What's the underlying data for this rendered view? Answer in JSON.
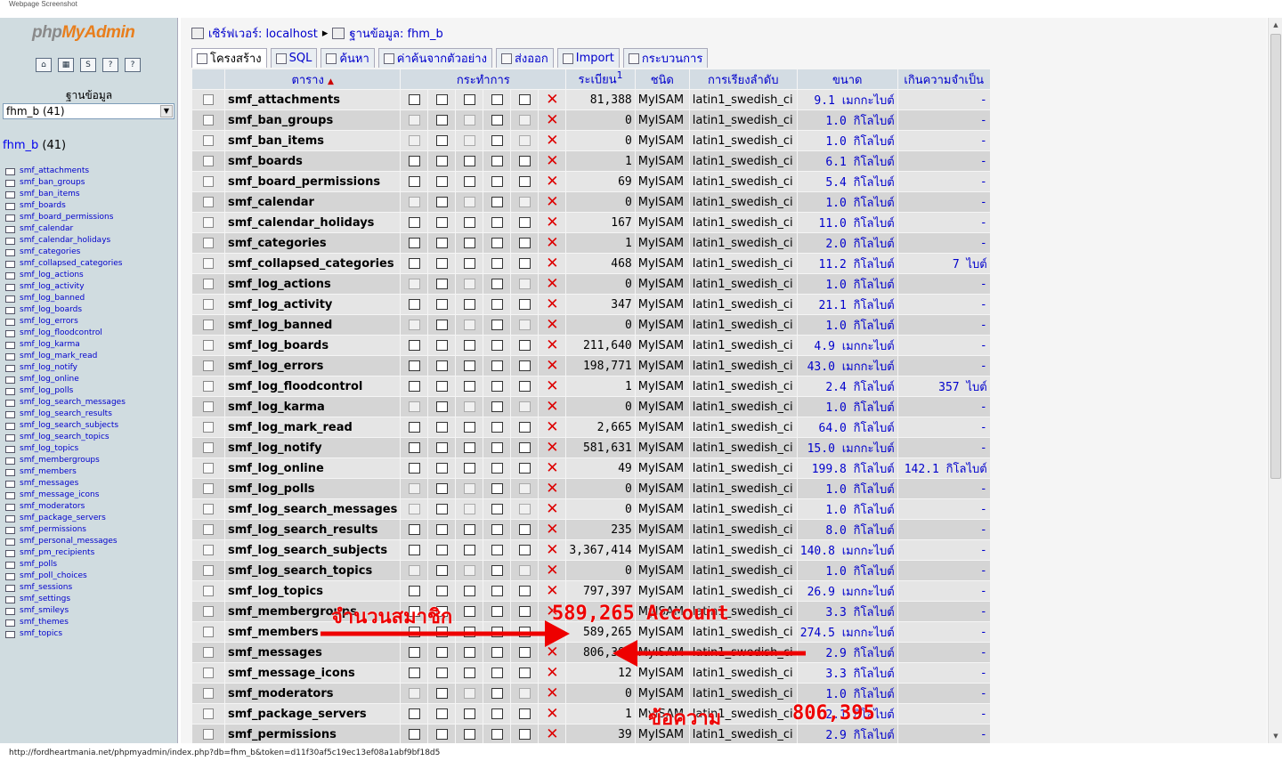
{
  "caption": "Webpage Screenshot",
  "status_url": "http://fordheartmania.net/phpmyadmin/index.php?db=fhm_b&token=d11f30af5c19ec13ef08a1abf9bf18d5",
  "left": {
    "logo": {
      "php": "php",
      "my": "My",
      "admin": "Admin"
    },
    "icons": [
      "home-icon",
      "query-window-icon",
      "sql-icon",
      "docs-icon",
      "help-icon"
    ],
    "db_label": "ฐานข้อมูล",
    "db_select": "fhm_b (41)",
    "db_link": "fhm_b",
    "db_count": "(41)",
    "tables": [
      "smf_attachments",
      "smf_ban_groups",
      "smf_ban_items",
      "smf_boards",
      "smf_board_permissions",
      "smf_calendar",
      "smf_calendar_holidays",
      "smf_categories",
      "smf_collapsed_categories",
      "smf_log_actions",
      "smf_log_activity",
      "smf_log_banned",
      "smf_log_boards",
      "smf_log_errors",
      "smf_log_floodcontrol",
      "smf_log_karma",
      "smf_log_mark_read",
      "smf_log_notify",
      "smf_log_online",
      "smf_log_polls",
      "smf_log_search_messages",
      "smf_log_search_results",
      "smf_log_search_subjects",
      "smf_log_search_topics",
      "smf_log_topics",
      "smf_membergroups",
      "smf_members",
      "smf_messages",
      "smf_message_icons",
      "smf_moderators",
      "smf_package_servers",
      "smf_permissions",
      "smf_personal_messages",
      "smf_pm_recipients",
      "smf_polls",
      "smf_poll_choices",
      "smf_sessions",
      "smf_settings",
      "smf_smileys",
      "smf_themes",
      "smf_topics"
    ]
  },
  "breadcrumb": {
    "server": "เซิร์ฟเวอร์: localhost",
    "database": "ฐานข้อมูล: fhm_b"
  },
  "tabs": [
    "โครงสร้าง",
    "SQL",
    "ค้นหา",
    "ค่าค้นจากตัวอย่าง",
    "ส่งออก",
    "Import",
    "กระบวนการ"
  ],
  "columns": {
    "table": "ตาราง",
    "action": "กระทำการ",
    "rows": "ระเบียน",
    "rows_sup": "1",
    "type": "ชนิด",
    "collation": "การเรียงลำดับ",
    "size": "ขนาด",
    "overhead": "เกินความจำเป็น"
  },
  "rows": [
    {
      "name": "smf_attachments",
      "rows": "81,388",
      "type": "MyISAM",
      "coll": "latin1_swedish_ci",
      "size": "9.1 เมกกะไบต์",
      "over": "-",
      "empty": false
    },
    {
      "name": "smf_ban_groups",
      "rows": "0",
      "type": "MyISAM",
      "coll": "latin1_swedish_ci",
      "size": "1.0 กิโลไบต์",
      "over": "-",
      "empty": true
    },
    {
      "name": "smf_ban_items",
      "rows": "0",
      "type": "MyISAM",
      "coll": "latin1_swedish_ci",
      "size": "1.0 กิโลไบต์",
      "over": "-",
      "empty": true
    },
    {
      "name": "smf_boards",
      "rows": "1",
      "type": "MyISAM",
      "coll": "latin1_swedish_ci",
      "size": "6.1 กิโลไบต์",
      "over": "-",
      "empty": false
    },
    {
      "name": "smf_board_permissions",
      "rows": "69",
      "type": "MyISAM",
      "coll": "latin1_swedish_ci",
      "size": "5.4 กิโลไบต์",
      "over": "-",
      "empty": false
    },
    {
      "name": "smf_calendar",
      "rows": "0",
      "type": "MyISAM",
      "coll": "latin1_swedish_ci",
      "size": "1.0 กิโลไบต์",
      "over": "-",
      "empty": true
    },
    {
      "name": "smf_calendar_holidays",
      "rows": "167",
      "type": "MyISAM",
      "coll": "latin1_swedish_ci",
      "size": "11.0 กิโลไบต์",
      "over": "-",
      "empty": false
    },
    {
      "name": "smf_categories",
      "rows": "1",
      "type": "MyISAM",
      "coll": "latin1_swedish_ci",
      "size": "2.0 กิโลไบต์",
      "over": "-",
      "empty": false
    },
    {
      "name": "smf_collapsed_categories",
      "rows": "468",
      "type": "MyISAM",
      "coll": "latin1_swedish_ci",
      "size": "11.2 กิโลไบต์",
      "over": "7 ไบต์",
      "empty": false
    },
    {
      "name": "smf_log_actions",
      "rows": "0",
      "type": "MyISAM",
      "coll": "latin1_swedish_ci",
      "size": "1.0 กิโลไบต์",
      "over": "-",
      "empty": true
    },
    {
      "name": "smf_log_activity",
      "rows": "347",
      "type": "MyISAM",
      "coll": "latin1_swedish_ci",
      "size": "21.1 กิโลไบต์",
      "over": "-",
      "empty": false
    },
    {
      "name": "smf_log_banned",
      "rows": "0",
      "type": "MyISAM",
      "coll": "latin1_swedish_ci",
      "size": "1.0 กิโลไบต์",
      "over": "-",
      "empty": true
    },
    {
      "name": "smf_log_boards",
      "rows": "211,640",
      "type": "MyISAM",
      "coll": "latin1_swedish_ci",
      "size": "4.9 เมกกะไบต์",
      "over": "-",
      "empty": false
    },
    {
      "name": "smf_log_errors",
      "rows": "198,771",
      "type": "MyISAM",
      "coll": "latin1_swedish_ci",
      "size": "43.0 เมกกะไบต์",
      "over": "-",
      "empty": false
    },
    {
      "name": "smf_log_floodcontrol",
      "rows": "1",
      "type": "MyISAM",
      "coll": "latin1_swedish_ci",
      "size": "2.4 กิโลไบต์",
      "over": "357 ไบต์",
      "empty": false
    },
    {
      "name": "smf_log_karma",
      "rows": "0",
      "type": "MyISAM",
      "coll": "latin1_swedish_ci",
      "size": "1.0 กิโลไบต์",
      "over": "-",
      "empty": true
    },
    {
      "name": "smf_log_mark_read",
      "rows": "2,665",
      "type": "MyISAM",
      "coll": "latin1_swedish_ci",
      "size": "64.0 กิโลไบต์",
      "over": "-",
      "empty": false
    },
    {
      "name": "smf_log_notify",
      "rows": "581,631",
      "type": "MyISAM",
      "coll": "latin1_swedish_ci",
      "size": "15.0 เมกกะไบต์",
      "over": "-",
      "empty": false
    },
    {
      "name": "smf_log_online",
      "rows": "49",
      "type": "MyISAM",
      "coll": "latin1_swedish_ci",
      "size": "199.8 กิโลไบต์",
      "over": "142.1 กิโลไบต์",
      "empty": false
    },
    {
      "name": "smf_log_polls",
      "rows": "0",
      "type": "MyISAM",
      "coll": "latin1_swedish_ci",
      "size": "1.0 กิโลไบต์",
      "over": "-",
      "empty": true
    },
    {
      "name": "smf_log_search_messages",
      "rows": "0",
      "type": "MyISAM",
      "coll": "latin1_swedish_ci",
      "size": "1.0 กิโลไบต์",
      "over": "-",
      "empty": true
    },
    {
      "name": "smf_log_search_results",
      "rows": "235",
      "type": "MyISAM",
      "coll": "latin1_swedish_ci",
      "size": "8.0 กิโลไบต์",
      "over": "-",
      "empty": false
    },
    {
      "name": "smf_log_search_subjects",
      "rows": "3,367,414",
      "type": "MyISAM",
      "coll": "latin1_swedish_ci",
      "size": "140.8 เมกกะไบต์",
      "over": "-",
      "empty": false
    },
    {
      "name": "smf_log_search_topics",
      "rows": "0",
      "type": "MyISAM",
      "coll": "latin1_swedish_ci",
      "size": "1.0 กิโลไบต์",
      "over": "-",
      "empty": true
    },
    {
      "name": "smf_log_topics",
      "rows": "797,397",
      "type": "MyISAM",
      "coll": "latin1_swedish_ci",
      "size": "26.9 เมกกะไบต์",
      "over": "-",
      "empty": false
    },
    {
      "name": "smf_membergroups",
      "rows": "",
      "type": "MyISAM",
      "coll": "latin1_swedish_ci",
      "size": "3.3 กิโลไบต์",
      "over": "-",
      "empty": false
    },
    {
      "name": "smf_members",
      "rows": "589,265",
      "type": "MyISAM",
      "coll": "latin1_swedish_ci",
      "size": "274.5 เมกกะไบต์",
      "over": "-",
      "empty": false
    },
    {
      "name": "smf_messages",
      "rows": "806,395",
      "type": "MyISAM",
      "coll": "latin1_swedish_ci",
      "size": "2.9 กิโลไบต์",
      "over": "-",
      "empty": false
    },
    {
      "name": "smf_message_icons",
      "rows": "12",
      "type": "MyISAM",
      "coll": "latin1_swedish_ci",
      "size": "3.3 กิโลไบต์",
      "over": "-",
      "empty": false
    },
    {
      "name": "smf_moderators",
      "rows": "0",
      "type": "MyISAM",
      "coll": "latin1_swedish_ci",
      "size": "1.0 กิโลไบต์",
      "over": "-",
      "empty": true
    },
    {
      "name": "smf_package_servers",
      "rows": "1",
      "type": "MyISAM",
      "coll": "latin1_swedish_ci",
      "size": "2.1 กิโลไบต์",
      "over": "-",
      "empty": false
    },
    {
      "name": "smf_permissions",
      "rows": "39",
      "type": "MyISAM",
      "coll": "latin1_swedish_ci",
      "size": "2.9 กิโลไบต์",
      "over": "-",
      "empty": false
    }
  ],
  "annotations": {
    "members_label": "จำนวนสมาชิก",
    "members_value": "589,265 Account",
    "messages_label": "ข้อความ",
    "messages_value": "806,395"
  }
}
